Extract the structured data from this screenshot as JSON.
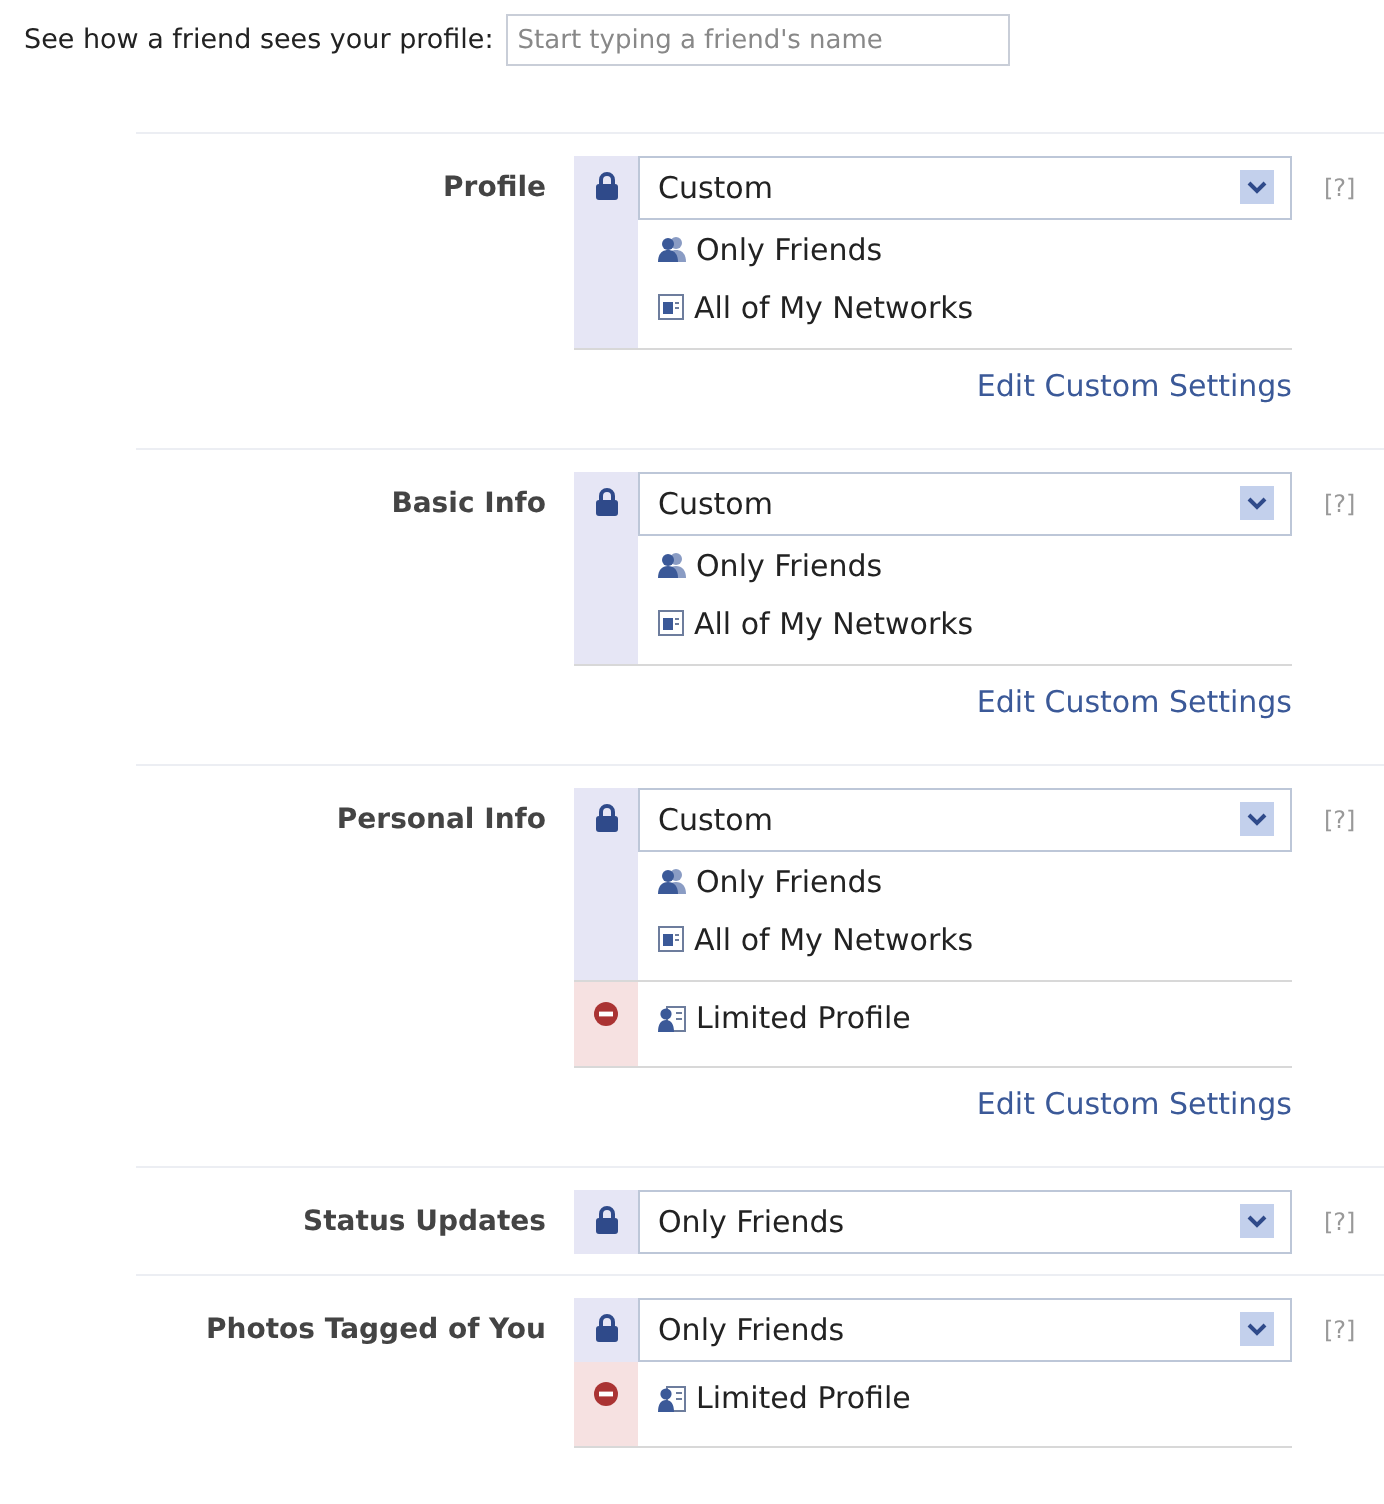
{
  "preview": {
    "label": "See how a friend sees your profile:",
    "placeholder": "Start typing a friend's name"
  },
  "settings": [
    {
      "label": "Profile",
      "value": "Custom",
      "allowed": [
        {
          "kind": "friends",
          "text": "Only Friends"
        },
        {
          "kind": "networks",
          "text": "All of My Networks"
        }
      ],
      "link": "Edit Custom Settings",
      "help": "[?]"
    },
    {
      "label": "Basic Info",
      "value": "Custom",
      "allowed": [
        {
          "kind": "friends",
          "text": "Only Friends"
        },
        {
          "kind": "networks",
          "text": "All of My Networks"
        }
      ],
      "link": "Edit Custom Settings",
      "help": "[?]"
    },
    {
      "label": "Personal Info",
      "value": "Custom",
      "allowed": [
        {
          "kind": "friends",
          "text": "Only Friends"
        },
        {
          "kind": "networks",
          "text": "All of My Networks"
        }
      ],
      "denied": [
        {
          "kind": "limited",
          "text": "Limited Profile"
        }
      ],
      "link": "Edit Custom Settings",
      "help": "[?]"
    },
    {
      "label": "Status Updates",
      "value": "Only Friends",
      "help": "[?]"
    },
    {
      "label": "Photos Tagged of You",
      "value": "Only Friends",
      "denied": [
        {
          "kind": "limited",
          "text": "Limited Profile"
        }
      ],
      "help": "[?]"
    }
  ]
}
